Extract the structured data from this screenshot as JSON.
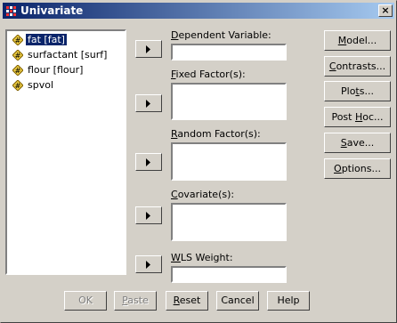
{
  "window": {
    "title": "Univariate",
    "close_label": "×"
  },
  "variables": [
    {
      "label": "fat [fat]",
      "icon": "scale-variable-icon",
      "selected": true
    },
    {
      "label": "surfactant [surf]",
      "icon": "scale-variable-icon",
      "selected": false
    },
    {
      "label": "flour [flour]",
      "icon": "scale-variable-icon",
      "selected": false
    },
    {
      "label": "spvol",
      "icon": "scale-variable-icon",
      "selected": false
    }
  ],
  "fields": {
    "dependent": {
      "label_pre": "",
      "label_key": "D",
      "label_post": "ependent Variable:"
    },
    "fixed": {
      "label_pre": "",
      "label_key": "F",
      "label_post": "ixed Factor(s):"
    },
    "random": {
      "label_pre": "",
      "label_key": "R",
      "label_post": "andom Factor(s):"
    },
    "covariate": {
      "label_pre": "",
      "label_key": "C",
      "label_post": "ovariate(s):"
    },
    "wls": {
      "label_pre": "",
      "label_key": "W",
      "label_post": "LS Weight:"
    }
  },
  "side_buttons": [
    {
      "pre": "",
      "key": "M",
      "post": "odel..."
    },
    {
      "pre": "",
      "key": "C",
      "post": "ontrasts..."
    },
    {
      "pre": "Plo",
      "key": "t",
      "post": "s..."
    },
    {
      "pre": "Post ",
      "key": "H",
      "post": "oc..."
    },
    {
      "pre": "",
      "key": "S",
      "post": "ave..."
    },
    {
      "pre": "",
      "key": "O",
      "post": "ptions..."
    }
  ],
  "bottom_buttons": {
    "ok": "OK",
    "paste_key": "P",
    "paste_rest": "aste",
    "reset_key": "R",
    "reset_rest": "eset",
    "cancel": "Cancel",
    "help": "Help"
  }
}
